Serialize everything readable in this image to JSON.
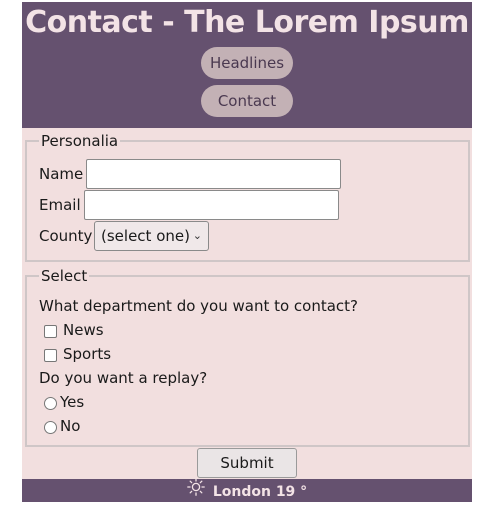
{
  "header": {
    "title": "Contact - The Lorem Ipsum",
    "nav": {
      "headlines": "Headlines",
      "contact": "Contact"
    }
  },
  "personalia": {
    "legend": "Personalia",
    "name_label": "Name",
    "name_value": "",
    "email_label": "Email",
    "email_value": "",
    "county_label": "County",
    "county_selected": "(select one)"
  },
  "select_section": {
    "legend": "Select",
    "department_question": "What department do you want to contact?",
    "departments": [
      "News",
      "Sports"
    ],
    "reply_question": "Do you want a replay?",
    "reply_options": [
      "Yes",
      "No"
    ]
  },
  "submit_label": "Submit",
  "footer": {
    "weather_icon": "sun-icon",
    "weather_text": "London 19 °"
  },
  "colors": {
    "header_bg": "#65516f",
    "page_bg": "#f2dfdf",
    "nav_button_bg": "#c3b1b5",
    "title_text": "#f3e3e6"
  }
}
